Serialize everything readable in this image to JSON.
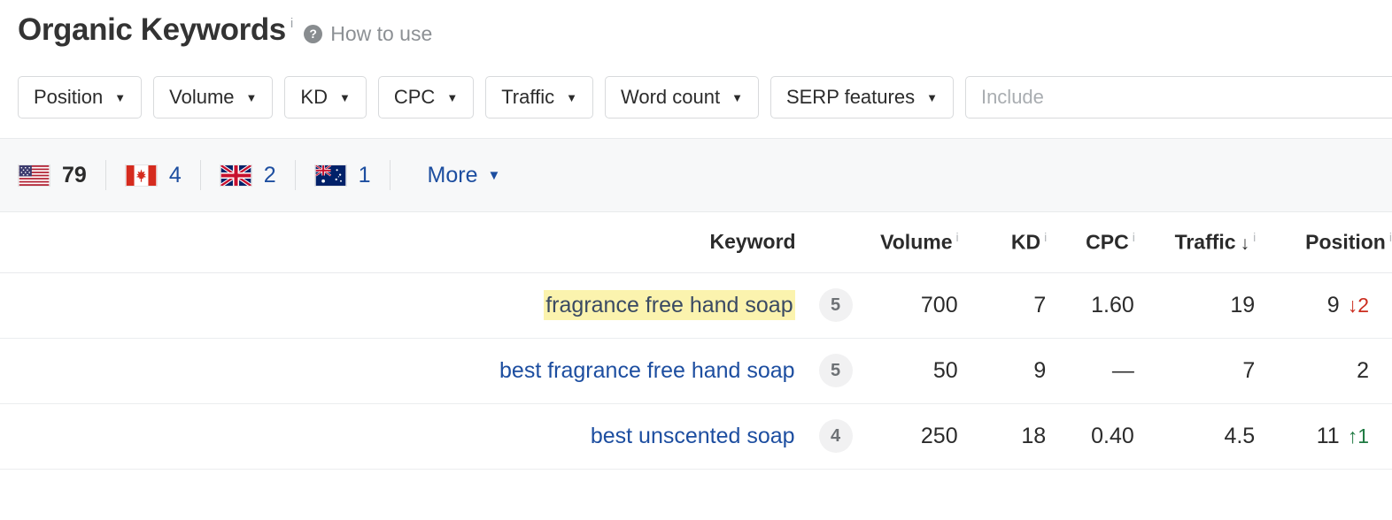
{
  "header": {
    "title": "Organic Keywords",
    "title_info_marker": "i",
    "help_icon": "question-mark-icon",
    "help_label": "How to use"
  },
  "filters": {
    "buttons": [
      {
        "label": "Position",
        "caret": "▼"
      },
      {
        "label": "Volume",
        "caret": "▼"
      },
      {
        "label": "KD",
        "caret": "▼"
      },
      {
        "label": "CPC",
        "caret": "▼"
      },
      {
        "label": "Traffic",
        "caret": "▼"
      },
      {
        "label": "Word count",
        "caret": "▼"
      },
      {
        "label": "SERP features",
        "caret": "▼"
      }
    ],
    "include": {
      "value": "",
      "placeholder": "Include"
    }
  },
  "countries": {
    "items": [
      {
        "flag": "us-flag-icon",
        "name": "United States",
        "count": "79",
        "active": true
      },
      {
        "flag": "ca-flag-icon",
        "name": "Canada",
        "count": "4",
        "active": false
      },
      {
        "flag": "gb-flag-icon",
        "name": "United Kingdom",
        "count": "2",
        "active": false
      },
      {
        "flag": "au-flag-icon",
        "name": "Australia",
        "count": "1",
        "active": false
      }
    ],
    "more_label": "More",
    "more_caret": "▼"
  },
  "table": {
    "columns": {
      "keyword": "Keyword",
      "word_count": "",
      "volume": "Volume",
      "kd": "KD",
      "cpc": "CPC",
      "traffic": "Traffic",
      "position": "Position"
    },
    "info_marker": "i",
    "sort": {
      "column": "traffic",
      "direction": "desc",
      "glyph": "↓"
    },
    "rows": [
      {
        "keyword": "fragrance free hand soap",
        "highlighted": true,
        "word_count": "5",
        "volume": "700",
        "kd": "7",
        "cpc": "1.60",
        "traffic": "19",
        "position": "9",
        "position_change": "2",
        "position_change_dir": "down",
        "position_change_glyph": "↓"
      },
      {
        "keyword": "best fragrance free hand soap",
        "highlighted": false,
        "word_count": "5",
        "volume": "50",
        "kd": "9",
        "cpc": "—",
        "traffic": "7",
        "position": "2",
        "position_change": "",
        "position_change_dir": "none",
        "position_change_glyph": ""
      },
      {
        "keyword": "best unscented soap",
        "highlighted": false,
        "word_count": "4",
        "volume": "250",
        "kd": "18",
        "cpc": "0.40",
        "traffic": "4.5",
        "position": "11",
        "position_change": "1",
        "position_change_dir": "up",
        "position_change_glyph": "↑"
      }
    ]
  },
  "colors": {
    "link": "#1d4ea0",
    "highlight": "#fbf3ae",
    "down": "#cb2c1e",
    "up": "#1f7a42",
    "band_bg": "#f7f8f9"
  }
}
